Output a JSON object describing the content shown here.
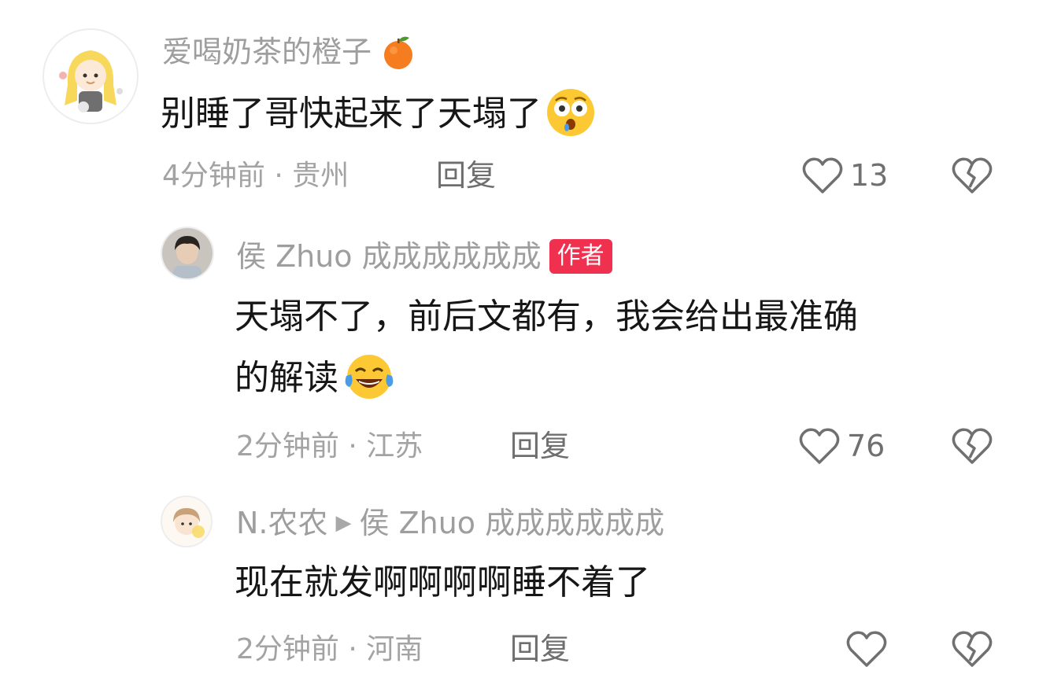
{
  "comments": [
    {
      "username": "爱喝奶茶的橙子",
      "text": "别睡了哥快起来了天塌了",
      "time": "4分钟前",
      "location": "贵州",
      "reply_label": "回复",
      "likes": "13"
    },
    {
      "username": "侯 Zhuo 成成成成成成",
      "badge": "作者",
      "text_line1": "天塌不了，前后文都有，我会给出最准确",
      "text_line2": "的解读",
      "time": "2分钟前",
      "location": "江苏",
      "reply_label": "回复",
      "likes": "76"
    },
    {
      "username": "N.农农",
      "reply_to": "侯 Zhuo 成成成成成成",
      "text": "现在就发啊啊啊啊睡不着了",
      "time": "2分钟前",
      "location": "河南",
      "reply_label": "回复",
      "likes": ""
    }
  ],
  "meta_separator": " · ",
  "colors": {
    "badge": "#f0304f",
    "username": "#9e9e9e",
    "content": "#161616",
    "meta": "#a3a3a3"
  },
  "icons": [
    "orange-emoji",
    "surprised-emoji",
    "laughing-tears-emoji",
    "heart-icon",
    "broken-heart-icon",
    "play-arrow-icon"
  ]
}
